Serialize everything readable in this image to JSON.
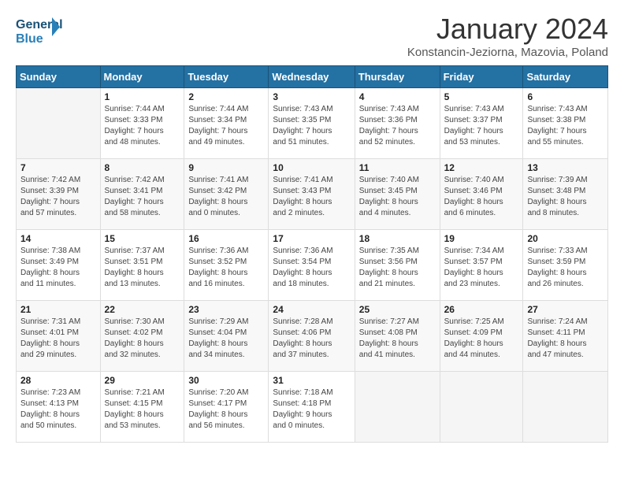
{
  "header": {
    "logo_line1": "General",
    "logo_line2": "Blue",
    "month": "January 2024",
    "location": "Konstancin-Jeziorna, Mazovia, Poland"
  },
  "days_of_week": [
    "Sunday",
    "Monday",
    "Tuesday",
    "Wednesday",
    "Thursday",
    "Friday",
    "Saturday"
  ],
  "weeks": [
    [
      {
        "day": "",
        "info": ""
      },
      {
        "day": "1",
        "info": "Sunrise: 7:44 AM\nSunset: 3:33 PM\nDaylight: 7 hours\nand 48 minutes."
      },
      {
        "day": "2",
        "info": "Sunrise: 7:44 AM\nSunset: 3:34 PM\nDaylight: 7 hours\nand 49 minutes."
      },
      {
        "day": "3",
        "info": "Sunrise: 7:43 AM\nSunset: 3:35 PM\nDaylight: 7 hours\nand 51 minutes."
      },
      {
        "day": "4",
        "info": "Sunrise: 7:43 AM\nSunset: 3:36 PM\nDaylight: 7 hours\nand 52 minutes."
      },
      {
        "day": "5",
        "info": "Sunrise: 7:43 AM\nSunset: 3:37 PM\nDaylight: 7 hours\nand 53 minutes."
      },
      {
        "day": "6",
        "info": "Sunrise: 7:43 AM\nSunset: 3:38 PM\nDaylight: 7 hours\nand 55 minutes."
      }
    ],
    [
      {
        "day": "7",
        "info": "Sunrise: 7:42 AM\nSunset: 3:39 PM\nDaylight: 7 hours\nand 57 minutes."
      },
      {
        "day": "8",
        "info": "Sunrise: 7:42 AM\nSunset: 3:41 PM\nDaylight: 7 hours\nand 58 minutes."
      },
      {
        "day": "9",
        "info": "Sunrise: 7:41 AM\nSunset: 3:42 PM\nDaylight: 8 hours\nand 0 minutes."
      },
      {
        "day": "10",
        "info": "Sunrise: 7:41 AM\nSunset: 3:43 PM\nDaylight: 8 hours\nand 2 minutes."
      },
      {
        "day": "11",
        "info": "Sunrise: 7:40 AM\nSunset: 3:45 PM\nDaylight: 8 hours\nand 4 minutes."
      },
      {
        "day": "12",
        "info": "Sunrise: 7:40 AM\nSunset: 3:46 PM\nDaylight: 8 hours\nand 6 minutes."
      },
      {
        "day": "13",
        "info": "Sunrise: 7:39 AM\nSunset: 3:48 PM\nDaylight: 8 hours\nand 8 minutes."
      }
    ],
    [
      {
        "day": "14",
        "info": "Sunrise: 7:38 AM\nSunset: 3:49 PM\nDaylight: 8 hours\nand 11 minutes."
      },
      {
        "day": "15",
        "info": "Sunrise: 7:37 AM\nSunset: 3:51 PM\nDaylight: 8 hours\nand 13 minutes."
      },
      {
        "day": "16",
        "info": "Sunrise: 7:36 AM\nSunset: 3:52 PM\nDaylight: 8 hours\nand 16 minutes."
      },
      {
        "day": "17",
        "info": "Sunrise: 7:36 AM\nSunset: 3:54 PM\nDaylight: 8 hours\nand 18 minutes."
      },
      {
        "day": "18",
        "info": "Sunrise: 7:35 AM\nSunset: 3:56 PM\nDaylight: 8 hours\nand 21 minutes."
      },
      {
        "day": "19",
        "info": "Sunrise: 7:34 AM\nSunset: 3:57 PM\nDaylight: 8 hours\nand 23 minutes."
      },
      {
        "day": "20",
        "info": "Sunrise: 7:33 AM\nSunset: 3:59 PM\nDaylight: 8 hours\nand 26 minutes."
      }
    ],
    [
      {
        "day": "21",
        "info": "Sunrise: 7:31 AM\nSunset: 4:01 PM\nDaylight: 8 hours\nand 29 minutes."
      },
      {
        "day": "22",
        "info": "Sunrise: 7:30 AM\nSunset: 4:02 PM\nDaylight: 8 hours\nand 32 minutes."
      },
      {
        "day": "23",
        "info": "Sunrise: 7:29 AM\nSunset: 4:04 PM\nDaylight: 8 hours\nand 34 minutes."
      },
      {
        "day": "24",
        "info": "Sunrise: 7:28 AM\nSunset: 4:06 PM\nDaylight: 8 hours\nand 37 minutes."
      },
      {
        "day": "25",
        "info": "Sunrise: 7:27 AM\nSunset: 4:08 PM\nDaylight: 8 hours\nand 41 minutes."
      },
      {
        "day": "26",
        "info": "Sunrise: 7:25 AM\nSunset: 4:09 PM\nDaylight: 8 hours\nand 44 minutes."
      },
      {
        "day": "27",
        "info": "Sunrise: 7:24 AM\nSunset: 4:11 PM\nDaylight: 8 hours\nand 47 minutes."
      }
    ],
    [
      {
        "day": "28",
        "info": "Sunrise: 7:23 AM\nSunset: 4:13 PM\nDaylight: 8 hours\nand 50 minutes."
      },
      {
        "day": "29",
        "info": "Sunrise: 7:21 AM\nSunset: 4:15 PM\nDaylight: 8 hours\nand 53 minutes."
      },
      {
        "day": "30",
        "info": "Sunrise: 7:20 AM\nSunset: 4:17 PM\nDaylight: 8 hours\nand 56 minutes."
      },
      {
        "day": "31",
        "info": "Sunrise: 7:18 AM\nSunset: 4:18 PM\nDaylight: 9 hours\nand 0 minutes."
      },
      {
        "day": "",
        "info": ""
      },
      {
        "day": "",
        "info": ""
      },
      {
        "day": "",
        "info": ""
      }
    ]
  ]
}
